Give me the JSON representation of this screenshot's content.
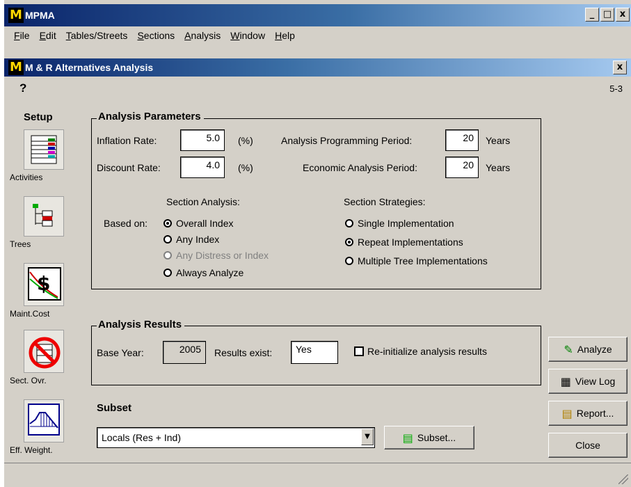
{
  "app": {
    "title": "MPMA",
    "logo_letter": "M"
  },
  "window_buttons": {
    "minimize": "_",
    "maximize": "□",
    "close": "x"
  },
  "menu": [
    "File",
    "Edit",
    "Tables/Streets",
    "Sections",
    "Analysis",
    "Window",
    "Help"
  ],
  "child_window": {
    "title": "M & R Alternatives Analysis",
    "close": "x",
    "page_id": "5-3",
    "help_icon": "?"
  },
  "sidebar": {
    "title": "Setup",
    "tools": [
      {
        "label": "Activities",
        "icon": "activities-icon"
      },
      {
        "label": "Trees",
        "icon": "trees-icon"
      },
      {
        "label": "Maint.Cost",
        "icon": "maint-cost-icon"
      },
      {
        "label": "Sect. Ovr.",
        "icon": "section-override-icon"
      },
      {
        "label": "Eff. Weight.",
        "icon": "effective-weight-icon"
      }
    ]
  },
  "analysis_parameters": {
    "title": "Analysis Parameters",
    "inflation_label": "Inflation Rate:",
    "inflation_value": "5.0",
    "inflation_unit": "(%)",
    "discount_label": "Discount Rate:",
    "discount_value": "4.0",
    "discount_unit": "(%)",
    "programming_label": "Analysis Programming Period:",
    "programming_value": "20",
    "programming_unit": "Years",
    "economic_label": "Economic Analysis Period:",
    "economic_value": "20",
    "economic_unit": "Years",
    "section_analysis_title": "Section Analysis:",
    "based_on_label": "Based on:",
    "section_analysis_options": [
      {
        "label": "Overall Index",
        "selected": true,
        "disabled": false
      },
      {
        "label": "Any Index",
        "selected": false,
        "disabled": false
      },
      {
        "label": "Any Distress or Index",
        "selected": false,
        "disabled": true
      },
      {
        "label": "Always Analyze",
        "selected": false,
        "disabled": false
      }
    ],
    "section_strategies_title": "Section Strategies:",
    "section_strategies_options": [
      {
        "label": "Single Implementation",
        "selected": false
      },
      {
        "label": "Repeat Implementations",
        "selected": true
      },
      {
        "label": "Multiple Tree Implementations",
        "selected": false
      }
    ]
  },
  "analysis_results": {
    "title": "Analysis Results",
    "base_year_label": "Base Year:",
    "base_year_value": "2005",
    "results_exist_label": "Results exist:",
    "results_exist_value": "Yes",
    "reinit_label": "Re-initialize analysis results",
    "reinit_checked": false
  },
  "subset": {
    "title": "Subset",
    "selected": "Locals (Res + Ind)",
    "button_label": "Subset..."
  },
  "actions": {
    "analyze": "Analyze",
    "view_log": "View Log",
    "report": "Report...",
    "close": "Close"
  }
}
